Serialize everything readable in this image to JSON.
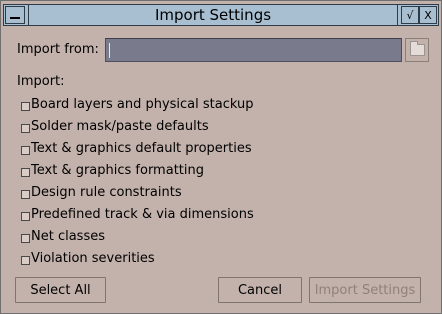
{
  "window": {
    "title": "Import Settings"
  },
  "import_from": {
    "label": "Import from:",
    "value": ""
  },
  "import_section": {
    "label": "Import:"
  },
  "options": [
    {
      "label": "Board layers and physical stackup",
      "checked": false
    },
    {
      "label": "Solder mask/paste defaults",
      "checked": false
    },
    {
      "label": "Text & graphics default properties",
      "checked": false
    },
    {
      "label": "Text & graphics formatting",
      "checked": false
    },
    {
      "label": "Design rule constraints",
      "checked": false
    },
    {
      "label": "Predefined track & via dimensions",
      "checked": false
    },
    {
      "label": "Net classes",
      "checked": false
    },
    {
      "label": "Violation severities",
      "checked": false
    }
  ],
  "buttons": {
    "select_all": "Select All",
    "cancel": "Cancel",
    "import_settings": "Import Settings"
  },
  "titlebar": {
    "maximize_glyph": "√",
    "close_glyph": "X"
  }
}
